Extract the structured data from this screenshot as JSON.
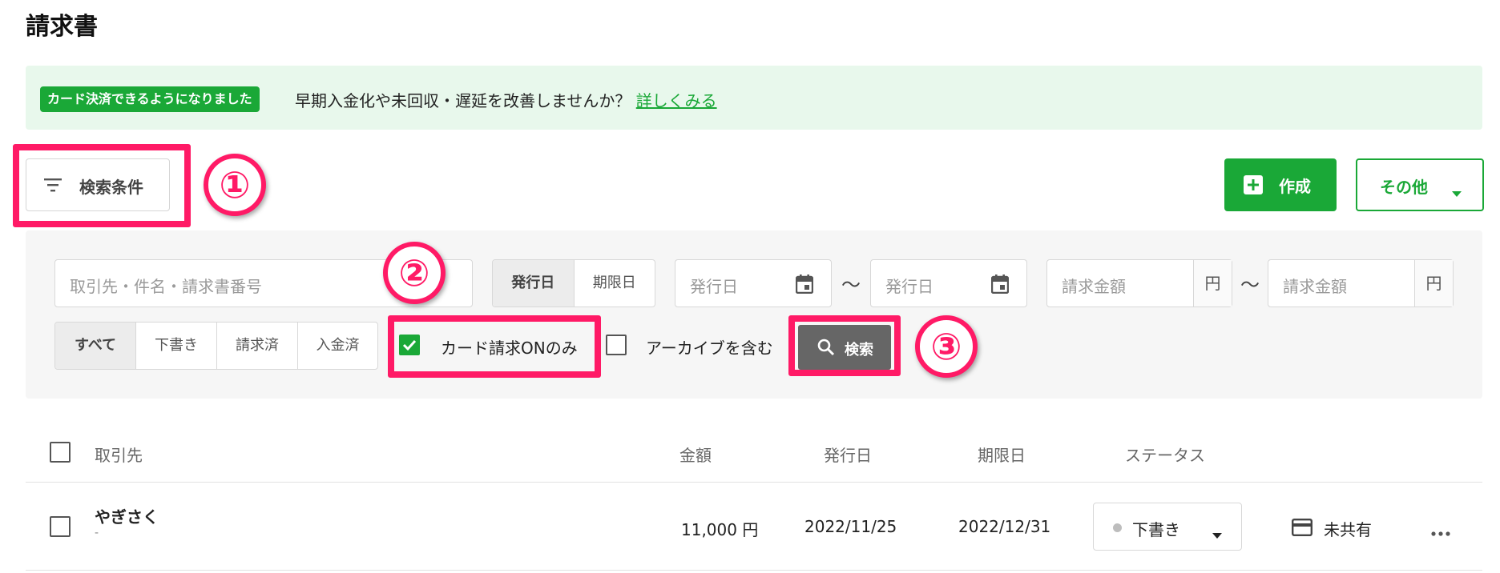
{
  "page": {
    "title": "請求書"
  },
  "banner": {
    "badge": "カード決済できるようになりました",
    "message": "早期入金化や未回収・遅延を改善しませんか？",
    "link": "詳しくみる"
  },
  "toolbar": {
    "filter_label": "検索条件",
    "create_label": "作成",
    "more_label": "その他"
  },
  "annotations": [
    "①",
    "②",
    "③"
  ],
  "search": {
    "keyword_placeholder": "取引先・件名・請求書番号",
    "date_type_tabs": [
      {
        "label": "発行日",
        "active": true
      },
      {
        "label": "期限日",
        "active": false
      }
    ],
    "date_from_placeholder": "発行日",
    "date_to_placeholder": "発行日",
    "range_separator": "〜",
    "amount_from_placeholder": "請求金額",
    "amount_to_placeholder": "請求金額",
    "currency_unit": "円",
    "status_tabs": [
      {
        "label": "すべて",
        "active": true
      },
      {
        "label": "下書き",
        "active": false
      },
      {
        "label": "請求済",
        "active": false
      },
      {
        "label": "入金済",
        "active": false
      }
    ],
    "card_only_label": "カード請求ONのみ",
    "card_only_checked": true,
    "archive_label": "アーカイブを含む",
    "archive_checked": false,
    "search_button_label": "検索"
  },
  "table": {
    "columns": [
      "取引先",
      "金額",
      "発行日",
      "期限日",
      "ステータス"
    ],
    "rows": [
      {
        "client": "やぎさく",
        "subtitle": "-",
        "amount": "11,000 円",
        "issue_date": "2022/11/25",
        "due_date": "2022/12/31",
        "status": "下書き",
        "share_status": "未共有"
      }
    ]
  },
  "colors": {
    "brand_green": "#1aa837",
    "highlight_pink": "#ff1a66",
    "banner_bg": "#e8f8ec",
    "panel_bg": "#f6f6f6"
  },
  "icons": [
    "filter-lines-icon",
    "plus-square-icon",
    "caret-down-icon",
    "calendar-icon",
    "search-icon",
    "check-icon",
    "credit-card-icon",
    "more-horizontal-icon"
  ]
}
